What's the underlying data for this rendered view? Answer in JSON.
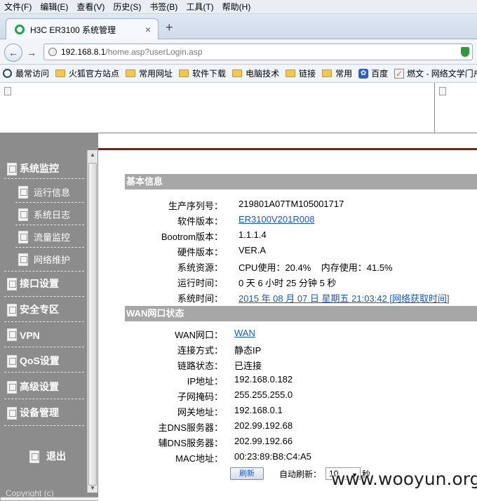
{
  "menubar": [
    "文件(F)",
    "编辑(E)",
    "查看(V)",
    "历史(S)",
    "书签(B)",
    "工具(T)",
    "帮助(H)"
  ],
  "tab": {
    "title": "H3C ER3100 系统管理",
    "close": "×",
    "new": "+"
  },
  "nav": {
    "back": "←",
    "forward": "→",
    "url_host": "192.168.8.1",
    "url_path": "/home.asp?userLogin.asp"
  },
  "bookmarks": [
    "最常访问",
    "火狐官方站点",
    "常用网址",
    "软件下载",
    "电脑技术",
    "链接",
    "常用",
    "百度",
    "燃文 - 网络文学门户"
  ],
  "sidebar": {
    "monitor": "系统监控",
    "sub": [
      "运行信息",
      "系统日志",
      "流量监控",
      "网络维护"
    ],
    "items": [
      "接口设置",
      "安全专区",
      "VPN",
      "QoS设置",
      "高级设置",
      "设备管理"
    ],
    "logout": "退出",
    "copyright": "Copyright (c)"
  },
  "basic": {
    "heading": "基本信息",
    "rows": [
      {
        "label": "生产序列号：",
        "value": "219801A07TM105001717"
      },
      {
        "label": "软件版本：",
        "value": "ER3100V201R008"
      },
      {
        "label": "Bootrom版本：",
        "value": "1.1.1.4"
      },
      {
        "label": "硬件版本：",
        "value": "VER.A"
      },
      {
        "label": "系统资源：",
        "value": "CPU使用：20.4%    内存使用：41.5%"
      },
      {
        "label": "运行时间：",
        "value": "0 天 6 小时 25 分钟 5 秒"
      },
      {
        "label": "系统时间：",
        "value": "2015 年 08 月 07 日 星期五 21:03:42 [网络获取时间]"
      }
    ]
  },
  "wan": {
    "heading": "WAN网口状态",
    "rows": [
      {
        "label": "WAN网口：",
        "value": "WAN"
      },
      {
        "label": "连接方式：",
        "value": "静态IP"
      },
      {
        "label": "链路状态：",
        "value": "已连接"
      },
      {
        "label": "IP地址：",
        "value": "192.168.0.182"
      },
      {
        "label": "子网掩码：",
        "value": "255.255.255.0"
      },
      {
        "label": "网关地址：",
        "value": "192.168.0.1"
      },
      {
        "label": "主DNS服务器：",
        "value": "202.99.192.68"
      },
      {
        "label": "辅DNS服务器：",
        "value": "202.99.192.66"
      },
      {
        "label": "MAC地址：",
        "value": "00:23:89:B8:C4:A5"
      }
    ]
  },
  "refresh": {
    "button": "刷新",
    "label": "自动刷新：",
    "interval": "10",
    "unit": "秒"
  },
  "watermark": "www.wooyun.org",
  "colors": {
    "sidebar": "#8c8c8c",
    "section": "#a7a7a7",
    "redline": "#a60f0f",
    "link": "#1b58b8"
  }
}
